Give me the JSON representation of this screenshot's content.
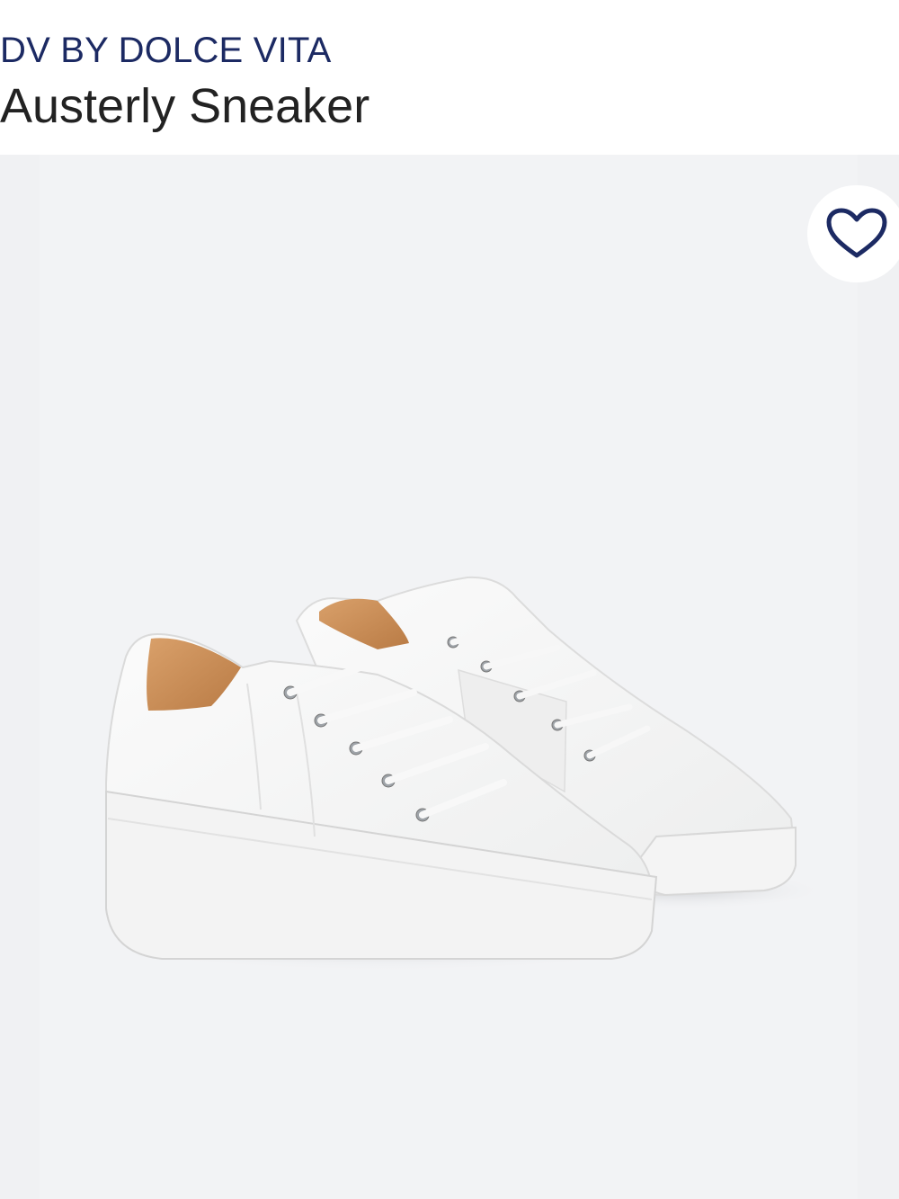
{
  "product": {
    "brand": "DV BY DOLCE VITA",
    "name": "Austerly Sneaker"
  },
  "colors": {
    "brand_text": "#1c2a63",
    "title_text": "#222222",
    "image_background": "#f0f1f3",
    "heart_stroke": "#1c2a63"
  },
  "icons": {
    "favorite": "heart-icon"
  }
}
